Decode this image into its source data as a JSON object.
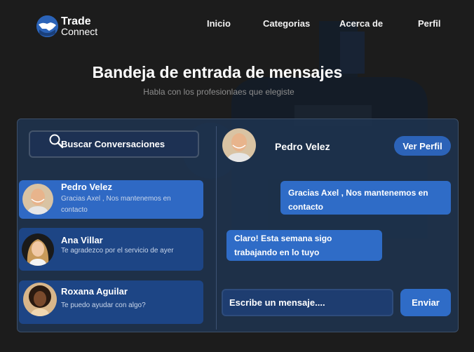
{
  "brand": {
    "line1": "Trade",
    "line2": "Connect"
  },
  "nav": {
    "items": [
      {
        "label": "Inicio"
      },
      {
        "label": "Categorias"
      },
      {
        "label": "Acerca de"
      },
      {
        "label": "Perfil"
      }
    ]
  },
  "hero": {
    "title": "Bandeja de entrada de mensajes",
    "subtitle": "Habla con los profesionlaes que elegiste"
  },
  "search": {
    "label": "Buscar Conversaciones"
  },
  "conversations": [
    {
      "name": "Pedro Velez",
      "preview": "Gracias Axel , Nos mantenemos en contacto"
    },
    {
      "name": "Ana Villar",
      "preview": "Te agradezco por el servicio de ayer"
    },
    {
      "name": "Roxana Aguilar",
      "preview": "Te puedo ayudar con algo?"
    }
  ],
  "chat": {
    "contact_name": "Pedro Velez",
    "profile_button": "Ver Perfil",
    "messages": [
      {
        "text": "Gracias Axel , Nos mantenemos en contacto"
      },
      {
        "text": "Claro! Esta semana sigo trabajando en lo tuyo"
      }
    ],
    "input_placeholder": "Escribe un mensaje....",
    "send_label": "Enviar"
  },
  "colors": {
    "accent": "#2f6cc7",
    "background": "#1c1c1c",
    "panel": "#1e3452"
  }
}
